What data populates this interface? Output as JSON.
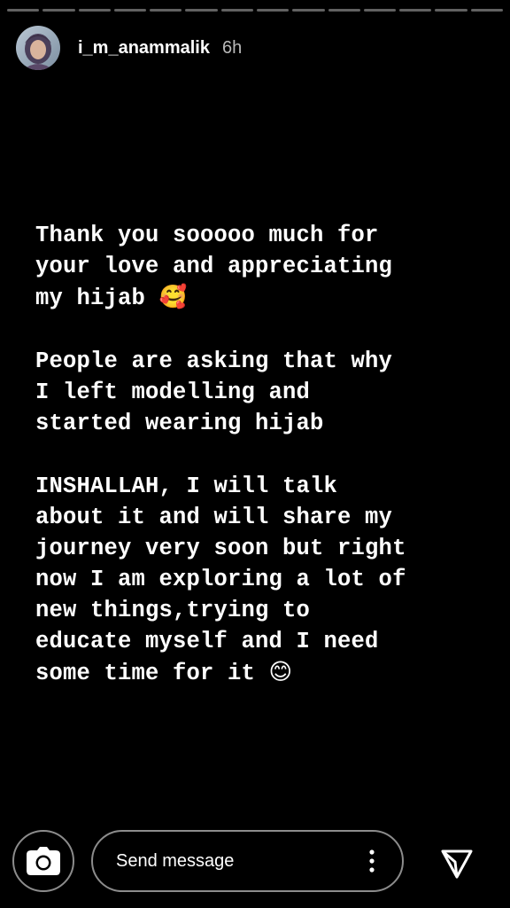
{
  "story": {
    "segment_count": 14,
    "active_segment": 0,
    "active_progress": 0.0,
    "colors": {
      "background": "#000000",
      "text": "#ffffff",
      "progress_track": "#9e9e9e",
      "progress_fill": "#ffffff"
    }
  },
  "header": {
    "username": "i_m_anammalik",
    "time_ago": "6h",
    "avatar_icon": "profile-avatar"
  },
  "content": {
    "paragraph1_text": "Thank you sooooo much for\nyour love and appreciating\nmy hijab ",
    "paragraph1_emoji": "🥰",
    "paragraph2_text": "People are asking that why\nI left modelling and\nstarted wearing hijab",
    "paragraph3_text": "INSHALLAH, I will talk\nabout it and will share my\njourney very soon but right\nnow I am exploring a lot of\nnew things,trying to\neducate myself and I need\nsome time for it ",
    "paragraph3_emoji": "😊"
  },
  "footer": {
    "message_placeholder": "Send message",
    "camera_icon": "camera-icon",
    "more_icon": "more-vertical-icon",
    "send_icon": "send-icon"
  }
}
